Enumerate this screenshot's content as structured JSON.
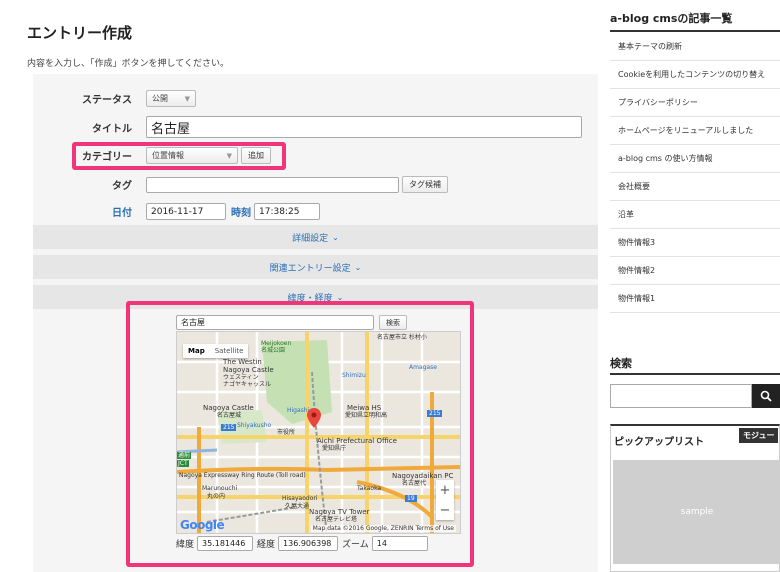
{
  "page": {
    "title": "エントリー作成",
    "instruction": "内容を入力し、「作成」ボタンを押してください。"
  },
  "form": {
    "status": {
      "label": "ステータス",
      "value": "公開"
    },
    "title": {
      "label": "タイトル",
      "value": "名古屋"
    },
    "category": {
      "label": "カテゴリー",
      "value": "位置情報",
      "add_button": "追加"
    },
    "tags": {
      "label": "タグ",
      "value": "",
      "candidates_button": "タグ候補"
    },
    "date": {
      "label": "日付",
      "value": "2016-11-17"
    },
    "time": {
      "label": "時刻",
      "value": "17:38:25"
    }
  },
  "sections": {
    "detail": "詳細設定",
    "related": "関連エントリー設定",
    "latlng": "緯度・経度"
  },
  "map": {
    "search_value": "名古屋",
    "search_button": "検索",
    "type_map": "Map",
    "type_satellite": "Satellite",
    "zoom_in": "+",
    "zoom_out": "−",
    "attribution": "Map data ©2016 Google, ZENRIN   Terms of Use",
    "google_logo": "Google",
    "labels": {
      "tl": "名古屋市立 杉村小",
      "meijokoen": "Meijokoen",
      "meijokoen_jp": "名城公園",
      "westin": "The Westin",
      "westin2": "Nagoya Castle",
      "westin3": "ウェスティン",
      "westin4": "ナゴヤキャッスル",
      "shimizu": "Shimizu",
      "amagase": "Amagase",
      "castle": "Nagoya Castle",
      "castle_jp": "名古屋城",
      "higashi": "Higashi",
      "meiwa": "Meiwa HS",
      "meiwa_jp": "愛知県立明和高",
      "shiyakusho": "Shiyakusho",
      "shiyakusho_jp": "市役所",
      "aichi": "Aichi Prefectural Office",
      "aichi_jp": "愛知県庁",
      "r215": "215",
      "r215b": "215",
      "expressway": "Nagoya Expressway Ring Route (Toll road)",
      "marunouchi": "Marunouchi",
      "marunouchi_jp": "丸の内",
      "hisayaodori": "Hisayaodori",
      "hisayaodori_jp": "久屋大通",
      "takaoka": "Takaoka",
      "nagoyadaikan": "Nagoyadaikan PC",
      "nagoyadaikan_jp": "名古屋代",
      "tvtower": "Nagoya TV Tower",
      "tvtower_jp": "名古屋テレビ塔",
      "jct": "JCT",
      "station": "通前",
      "r19": "19"
    }
  },
  "latlng": {
    "lat_label": "緯度",
    "lat_value": "35.181446",
    "lng_label": "経度",
    "lng_value": "136.906398",
    "zoom_label": "ズーム",
    "zoom_value": "14"
  },
  "sidebar": {
    "articles_title": "a-blog cmsの記事一覧",
    "articles": [
      "基本テーマの刷新",
      "Cookieを利用したコンテンツの切り替え",
      "プライバシーポリシー",
      "ホームページをリニューアルしました",
      "a-blog cms の使い方情報",
      "会社概要",
      "沿革",
      "物件情報3",
      "物件情報2",
      "物件情報1"
    ],
    "search_title": "検索",
    "pickup_title": "ピックアップリスト",
    "module_badge": "モジュー",
    "sample": "sample"
  },
  "colors": {
    "highlight": "#f0357a",
    "link_blue": "#2b6fb5",
    "marker_red": "#e8463e"
  }
}
